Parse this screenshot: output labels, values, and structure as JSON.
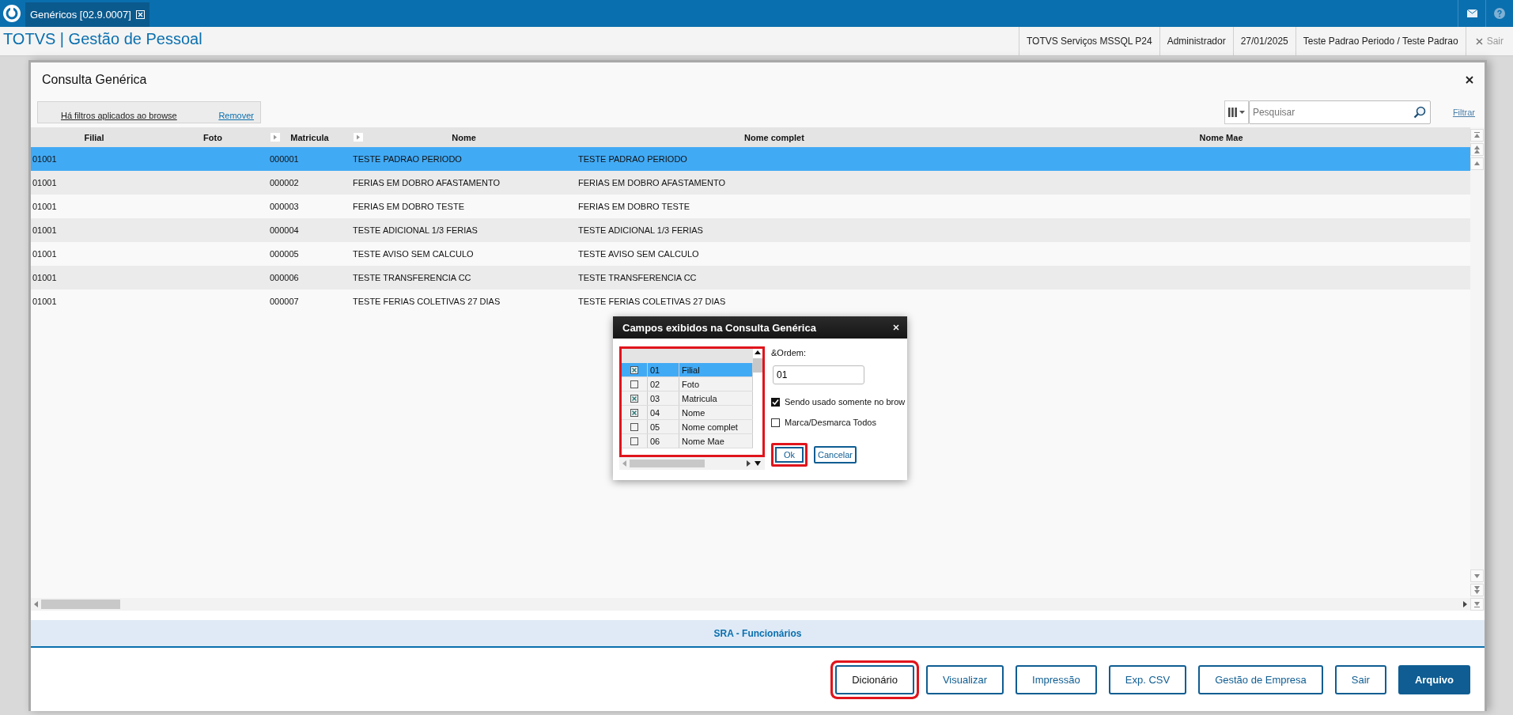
{
  "app": {
    "tab": {
      "label": "Genéricos [02.9.0007]",
      "selected": true
    },
    "title": "TOTVS | Gestão de Pessoal",
    "session": [
      "TOTVS Serviços MSSQL P24",
      "Administrador",
      "27/01/2025",
      "Teste Padrao Periodo / Teste Padrao"
    ],
    "exit_label": "Sair"
  },
  "window": {
    "title": "Consulta Genérica",
    "filter": {
      "message": "Há filtros aplicados ao browse",
      "remove": "Remover"
    },
    "search": {
      "placeholder": "Pesquisar"
    },
    "filter_link": "Filtrar",
    "table": {
      "columns": [
        {
          "label": "Filial",
          "sortable": false
        },
        {
          "label": "Foto",
          "sortable": false
        },
        {
          "label": "Matricula",
          "sortable": true
        },
        {
          "label": "Nome",
          "sortable": true
        },
        {
          "label": "Nome complet",
          "sortable": false
        },
        {
          "label": "Nome Mae",
          "sortable": false
        }
      ],
      "rows": [
        {
          "cells": [
            "01001",
            "",
            "000001",
            "TESTE PADRAO PERIODO",
            "TESTE PADRAO PERIODO"
          ],
          "selected": true
        },
        {
          "cells": [
            "01001",
            "",
            "000002",
            "FERIAS EM DOBRO AFASTAMENTO",
            "FERIAS EM DOBRO AFASTAMENTO"
          ],
          "selected": false
        },
        {
          "cells": [
            "01001",
            "",
            "000003",
            "FERIAS EM DOBRO TESTE",
            "FERIAS EM DOBRO TESTE"
          ],
          "selected": false
        },
        {
          "cells": [
            "01001",
            "",
            "000004",
            "TESTE ADICIONAL 1/3 FERIAS",
            "TESTE ADICIONAL 1/3 FERIAS"
          ],
          "selected": false
        },
        {
          "cells": [
            "01001",
            "",
            "000005",
            "TESTE AVISO SEM CALCULO",
            "TESTE AVISO SEM CALCULO"
          ],
          "selected": false
        },
        {
          "cells": [
            "01001",
            "",
            "000006",
            "TESTE TRANSFERENCIA CC",
            "TESTE TRANSFERENCIA CC"
          ],
          "selected": false
        },
        {
          "cells": [
            "01001",
            "",
            "000007",
            "TESTE FERIAS COLETIVAS 27 DIAS",
            "TESTE FERIAS COLETIVAS 27 DIAS"
          ],
          "selected": false
        }
      ]
    },
    "footer_label": "SRA - Funcionários",
    "buttons": [
      {
        "label": "Dicionário",
        "kind": "outline",
        "highlighted": true
      },
      {
        "label": "Visualizar",
        "kind": "outline",
        "highlighted": false
      },
      {
        "label": "Impressão",
        "kind": "outline",
        "highlighted": false
      },
      {
        "label": "Exp. CSV",
        "kind": "outline",
        "highlighted": false
      },
      {
        "label": "Gestão de Empresa",
        "kind": "outline",
        "highlighted": false
      },
      {
        "label": "Sair",
        "kind": "outline",
        "highlighted": false
      },
      {
        "label": "Arquivo",
        "kind": "primary",
        "highlighted": false
      }
    ]
  },
  "dialog": {
    "title": "Campos exibidos na Consulta Genérica",
    "list_highlighted": true,
    "fields": [
      {
        "number": "01",
        "label": "Filial",
        "checked": true,
        "selected": true
      },
      {
        "number": "02",
        "label": "Foto",
        "checked": false,
        "selected": false
      },
      {
        "number": "03",
        "label": "Matricula",
        "checked": true,
        "selected": false
      },
      {
        "number": "04",
        "label": "Nome",
        "checked": true,
        "selected": false
      },
      {
        "number": "05",
        "label": "Nome complet",
        "checked": false,
        "selected": false
      },
      {
        "number": "06",
        "label": "Nome Mae",
        "checked": false,
        "selected": false
      }
    ],
    "order_label": "&Ordem:",
    "order_value": "01",
    "options": [
      {
        "label": "Sendo usado somente no brow",
        "checked": true
      },
      {
        "label": "Marca/Desmarca Todos",
        "checked": false
      }
    ],
    "buttons": [
      {
        "label": "Ok",
        "highlighted": true
      },
      {
        "label": "Cancelar",
        "highlighted": false
      }
    ]
  }
}
